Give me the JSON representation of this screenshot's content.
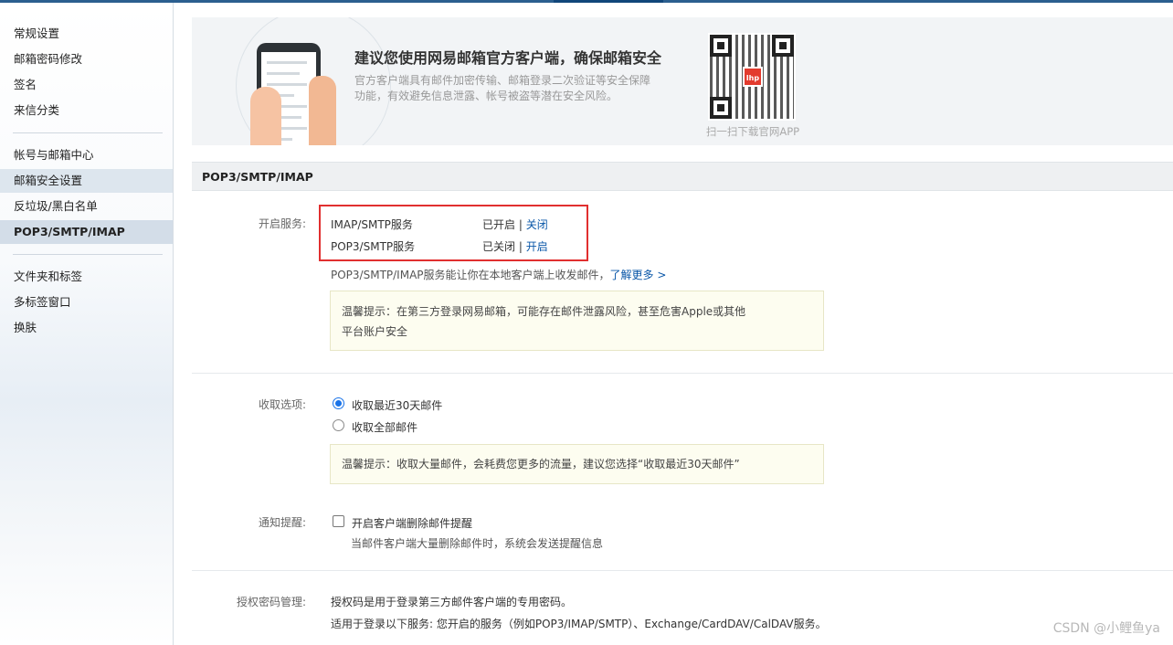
{
  "sidebar": {
    "items": [
      {
        "label": "常规设置"
      },
      {
        "label": "邮箱密码修改"
      },
      {
        "label": "签名"
      },
      {
        "label": "来信分类"
      },
      {
        "label": "帐号与邮箱中心"
      },
      {
        "label": "邮箱安全设置"
      },
      {
        "label": "反垃圾/黑白名单"
      },
      {
        "label": "POP3/SMTP/IMAP"
      },
      {
        "label": "文件夹和标签"
      },
      {
        "label": "多标签窗口"
      },
      {
        "label": "换肤"
      }
    ]
  },
  "banner": {
    "title": "建议您使用网易邮箱官方客户端，确保邮箱安全",
    "desc": "官方客户端具有邮件加密传输、邮箱登录二次验证等安全保障功能，有效避免信息泄露、帐号被盗等潜在安全风险。",
    "qr_logo": "lhp",
    "qr_caption": "扫一扫下载官网APP"
  },
  "section": {
    "title": "POP3/SMTP/IMAP"
  },
  "services": {
    "label": "开启服务:",
    "rows": [
      {
        "name": "IMAP/SMTP服务",
        "status": "已开启",
        "sep": " | ",
        "action": "关闭"
      },
      {
        "name": "POP3/SMTP服务",
        "status": "已关闭",
        "sep": " | ",
        "action": "开启"
      }
    ],
    "desc": "POP3/SMTP/IMAP服务能让你在本地客户端上收发邮件，",
    "learn_more": "了解更多 >",
    "tip_line1": "温馨提示：在第三方登录网易邮箱，可能存在邮件泄露风险，甚至危害Apple或其他",
    "tip_line2": "平台账户安全"
  },
  "receive": {
    "label": "收取选项:",
    "options": [
      {
        "label": "收取最近30天邮件",
        "checked": true
      },
      {
        "label": "收取全部邮件",
        "checked": false
      }
    ],
    "tip": "温馨提示：收取大量邮件，会耗费您更多的流量，建议您选择“收取最近30天邮件”"
  },
  "notify": {
    "label": "通知提醒:",
    "checkbox_label": "开启客户端删除邮件提醒",
    "checked": false,
    "desc": "当邮件客户端大量删除邮件时，系统会发送提醒信息"
  },
  "auth": {
    "label": "授权密码管理:",
    "line1": "授权码是用于登录第三方邮件客户端的专用密码。",
    "line2": "适用于登录以下服务: 您开启的服务（例如POP3/IMAP/SMTP）、Exchange/CardDAV/CalDAV服务。"
  },
  "watermark": "CSDN @小鲤鱼ya",
  "colors": {
    "accent": "#0a57a8",
    "highlight_box": "#e12f2f",
    "radio": "#1a73e8"
  }
}
